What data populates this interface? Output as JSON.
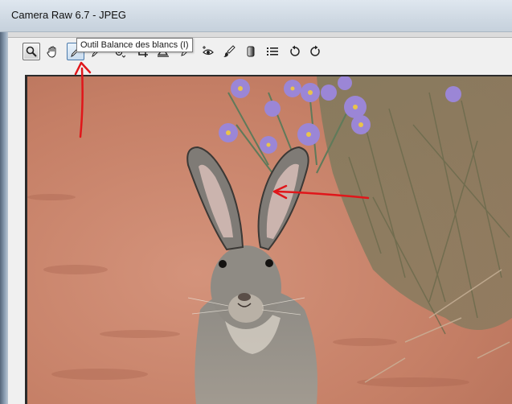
{
  "window": {
    "title": "Camera Raw 6.7  -  JPEG"
  },
  "toolbar": {
    "tools": [
      {
        "name": "zoom-tool",
        "icon": "magnifier-icon",
        "state": "active"
      },
      {
        "name": "hand-tool",
        "icon": "hand-icon",
        "state": "normal"
      },
      {
        "name": "white-balance-tool",
        "icon": "eyedropper-icon",
        "state": "hover"
      },
      {
        "name": "color-sampler-tool",
        "icon": "color-sampler-icon",
        "state": "normal"
      },
      {
        "name": "targeted-adjustment-tool",
        "icon": "target-adjust-icon",
        "state": "normal"
      },
      {
        "name": "crop-tool",
        "icon": "crop-icon",
        "state": "normal"
      },
      {
        "name": "straighten-tool",
        "icon": "straighten-icon",
        "state": "normal"
      },
      {
        "name": "spot-removal-tool",
        "icon": "spot-removal-icon",
        "state": "normal"
      },
      {
        "name": "red-eye-tool",
        "icon": "red-eye-icon",
        "state": "normal"
      },
      {
        "name": "adjustment-brush-tool",
        "icon": "brush-icon",
        "state": "normal"
      },
      {
        "name": "graduated-filter-tool",
        "icon": "graduated-filter-icon",
        "state": "normal"
      },
      {
        "name": "preferences",
        "icon": "list-icon",
        "state": "normal"
      },
      {
        "name": "rotate-left",
        "icon": "rotate-ccw-icon",
        "state": "normal"
      },
      {
        "name": "rotate-right",
        "icon": "rotate-cw-icon",
        "state": "normal"
      }
    ]
  },
  "tooltip": {
    "text": "Outil Balance des blancs (I)"
  },
  "colors": {
    "annotation": "#e0161a",
    "ground": "#c8826a",
    "flowers": "#9b86d6"
  }
}
